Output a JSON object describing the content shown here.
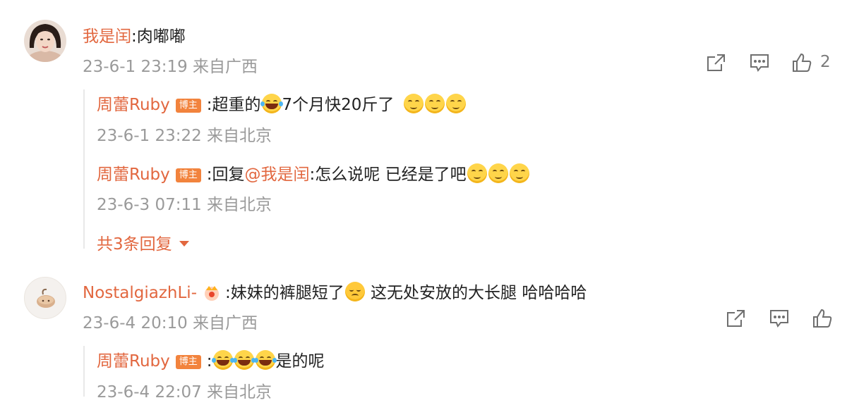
{
  "comments": [
    {
      "user": "我是闰",
      "text": ":肉嘟嘟",
      "time": "23-6-1 23:19 来自广西",
      "like_count": "2",
      "replies": [
        {
          "user": "周蕾Ruby",
          "badge": "博主",
          "text_a": ":超重的",
          "text_b": "7个月快20斤了",
          "time": "23-6-1 23:22 来自北京"
        },
        {
          "user": "周蕾Ruby",
          "badge": "博主",
          "prefix": ":回复",
          "mention": "@我是闰",
          "text_a": ":怎么说呢 已经是了吧",
          "time": "23-6-3 07:11 来自北京"
        }
      ],
      "more_replies": "共3条回复"
    },
    {
      "user": "NostalgiazhLi-",
      "text_a": ":妹妹的裤腿短了",
      "text_b": " 这无处安放的大长腿 哈哈哈哈",
      "time": "23-6-4 20:10 来自广西",
      "replies": [
        {
          "user": "周蕾Ruby",
          "badge": "博主",
          "text_a": ":",
          "text_b": "是的呢",
          "time": "23-6-4 22:07 来自北京"
        }
      ]
    }
  ],
  "icons": [
    "share-icon",
    "comment-icon",
    "like-icon",
    "chevron-down-icon",
    "crown-icon"
  ],
  "colors": {
    "name": "#e2673f",
    "meta": "#9a9a9a",
    "badge": "#f2833d"
  }
}
